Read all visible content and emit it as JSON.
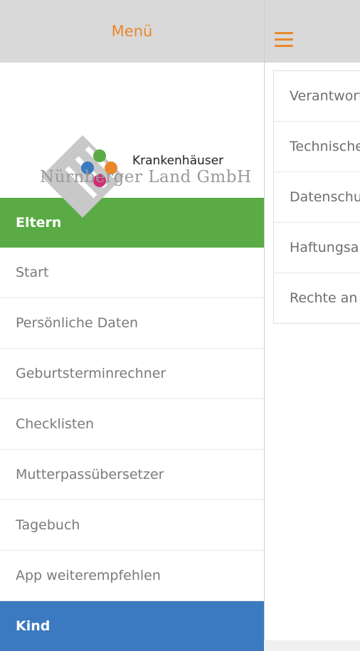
{
  "drawer": {
    "title": "Menü",
    "logo": {
      "line1": "Krankenhäuser",
      "line2": "Nürnberger Land GmbH"
    },
    "sections": [
      {
        "label": "Eltern",
        "color": "#5aab45"
      },
      {
        "label": "Kind",
        "color": "#3b7ac0"
      }
    ],
    "items": [
      "Start",
      "Persönliche Daten",
      "Geburtsterminrechner",
      "Checklisten",
      "Mutterpassübersetzer",
      "Tagebuch",
      "App weiterempfehlen"
    ]
  },
  "content": {
    "menu_icon": "hamburger-icon",
    "list": [
      "Verantwortlich",
      "Technische",
      "Datenschutz",
      "Haftungsausschluss",
      "Rechte an"
    ]
  },
  "colors": {
    "accent": "#e8882a",
    "header_bg": "#d9d9d9"
  }
}
